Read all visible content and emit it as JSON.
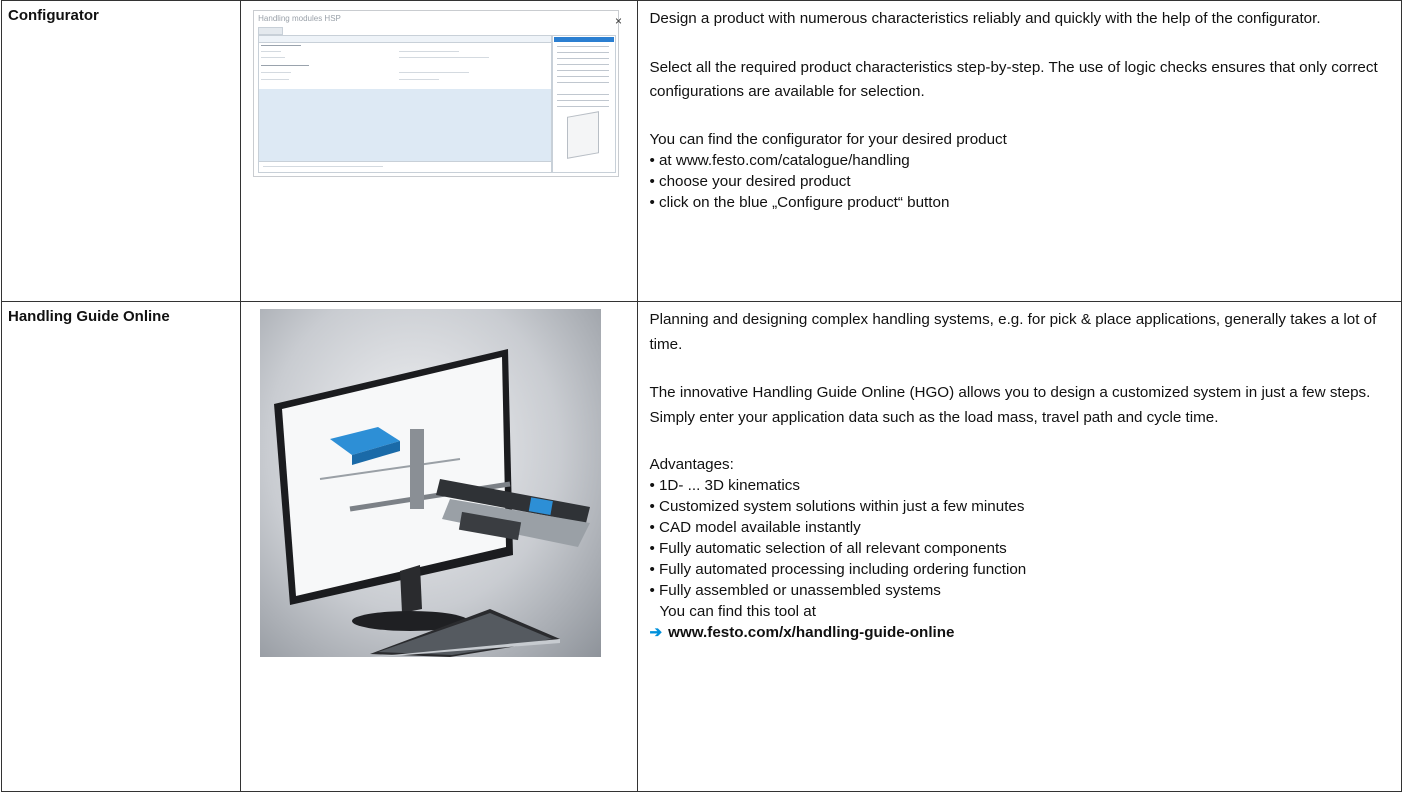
{
  "rows": [
    {
      "label": "Configurator",
      "paragraphs": [
        "Design a product with numerous characteristics reliably and quickly with the help of the configurator.",
        "Select all the required product characteristics step-by-step. The use of logic checks ensures that only correct configurations are available for selection."
      ],
      "list_intro": "You can find the configurator for your desired product",
      "bullets": [
        "• at www.festo.com/catalogue/handling",
        "• choose your desired product",
        "• click on the blue „Configure product“ button"
      ],
      "screenshot": {
        "title": "Handling modules HSP",
        "close_glyph": "×"
      }
    },
    {
      "label": "Handling Guide Online",
      "paragraphs": [
        "Planning and designing complex handling systems, e.g. for pick & place applications, generally takes a lot of time.",
        "The innovative Handling Guide Online (HGO) allows you to design a customized system in just a few steps. Simply enter your application data such as the load mass, travel path and cycle time."
      ],
      "list_intro": "Advantages:",
      "bullets": [
        "• 1D- ... 3D kinematics",
        "• Customized system solutions within just a few minutes",
        "• CAD model available instantly",
        "• Fully automatic selection of all relevant components",
        "• Fully automated processing including ordering function",
        "• Fully assembled or unassembled systems"
      ],
      "tool_line": "You can find this tool at",
      "link_arrow": "➔",
      "link": "www.festo.com/x/handling-guide-online"
    }
  ],
  "colors": {
    "link_arrow": "#0091dc",
    "config_selected": "#2b7fd1",
    "config_area": "#dde9f4"
  }
}
